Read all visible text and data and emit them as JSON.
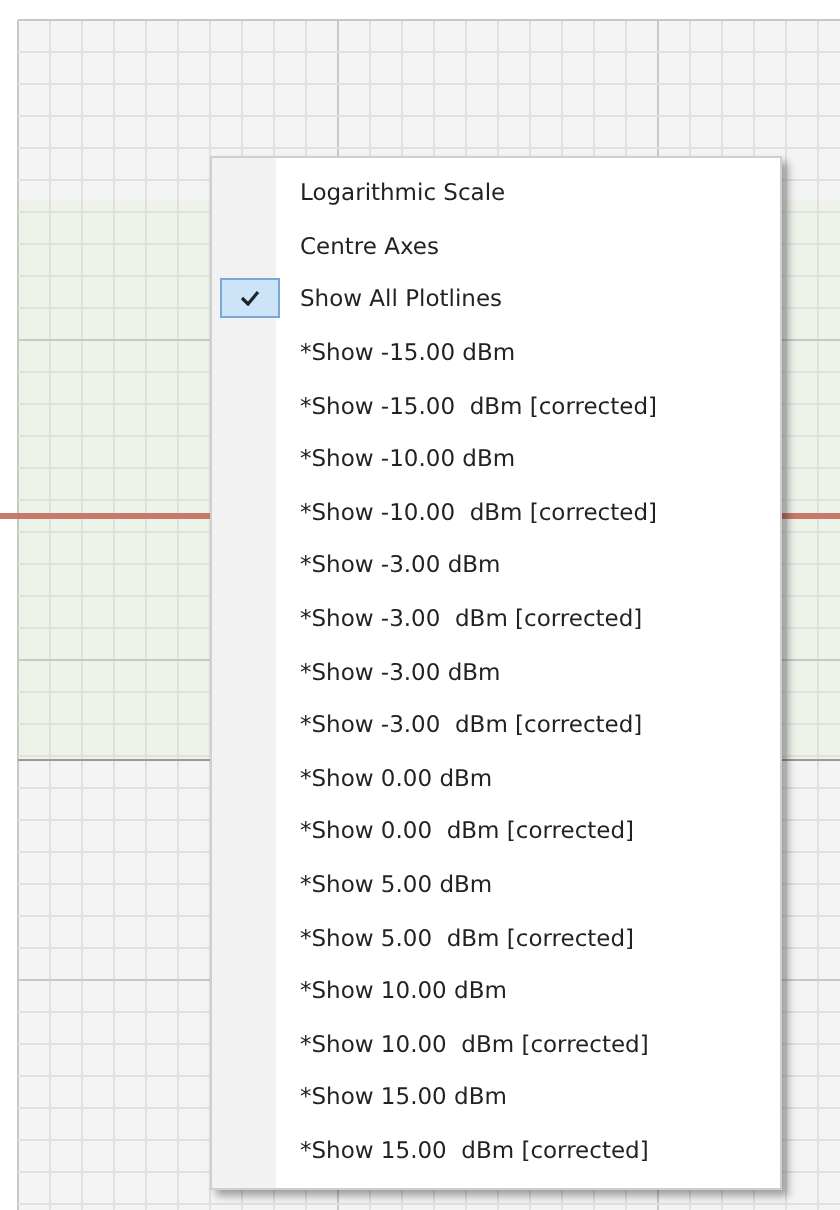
{
  "context_menu": {
    "items": [
      {
        "label": "Logarithmic Scale",
        "checked": false
      },
      {
        "label": "Centre Axes",
        "checked": false
      },
      {
        "label": "Show All Plotlines",
        "checked": true
      },
      {
        "label": "*Show -15.00 dBm",
        "checked": false
      },
      {
        "label": "*Show -15.00  dBm [corrected]",
        "checked": false
      },
      {
        "label": "*Show -10.00 dBm",
        "checked": false
      },
      {
        "label": "*Show -10.00  dBm [corrected]",
        "checked": false
      },
      {
        "label": "*Show -3.00 dBm",
        "checked": false
      },
      {
        "label": "*Show -3.00  dBm [corrected]",
        "checked": false
      },
      {
        "label": "*Show -3.00 dBm",
        "checked": false
      },
      {
        "label": "*Show -3.00  dBm [corrected]",
        "checked": false
      },
      {
        "label": "*Show 0.00 dBm",
        "checked": false
      },
      {
        "label": "*Show 0.00  dBm [corrected]",
        "checked": false
      },
      {
        "label": "*Show 5.00 dBm",
        "checked": false
      },
      {
        "label": "*Show 5.00  dBm [corrected]",
        "checked": false
      },
      {
        "label": "*Show 10.00 dBm",
        "checked": false
      },
      {
        "label": "*Show 10.00  dBm [corrected]",
        "checked": false
      },
      {
        "label": "*Show 15.00 dBm",
        "checked": false
      },
      {
        "label": "*Show 15.00  dBm [corrected]",
        "checked": false
      }
    ]
  }
}
